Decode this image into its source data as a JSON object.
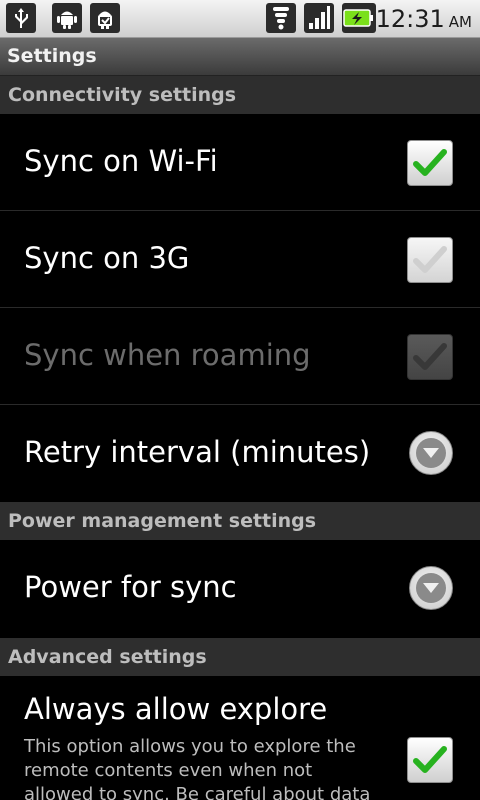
{
  "status_bar": {
    "time": "12:31",
    "ampm": "AM",
    "icons": [
      "usb-icon",
      "android-icon",
      "debug-icon",
      "wifi-icon",
      "signal-icon",
      "battery-charging-icon"
    ]
  },
  "title": "Settings",
  "sections": {
    "connectivity": "Connectivity settings",
    "power": "Power management settings",
    "advanced": "Advanced settings"
  },
  "rows": {
    "sync_wifi": {
      "label": "Sync on Wi-Fi",
      "checked": true
    },
    "sync_3g": {
      "label": "Sync on 3G",
      "checked": false
    },
    "sync_roaming": {
      "label": "Sync when roaming",
      "checked": false,
      "enabled": false
    },
    "retry_interval": {
      "label": "Retry interval (minutes)"
    },
    "power_for_sync": {
      "label": "Power for sync"
    },
    "always_allow_explore": {
      "label": "Always allow explore",
      "desc": "This option allows you to explore the remote contents even when not allowed to sync. Be careful about data",
      "checked": true
    }
  },
  "colors": {
    "check_green": "#27b21f",
    "section_bg": "#2e2e2e"
  }
}
